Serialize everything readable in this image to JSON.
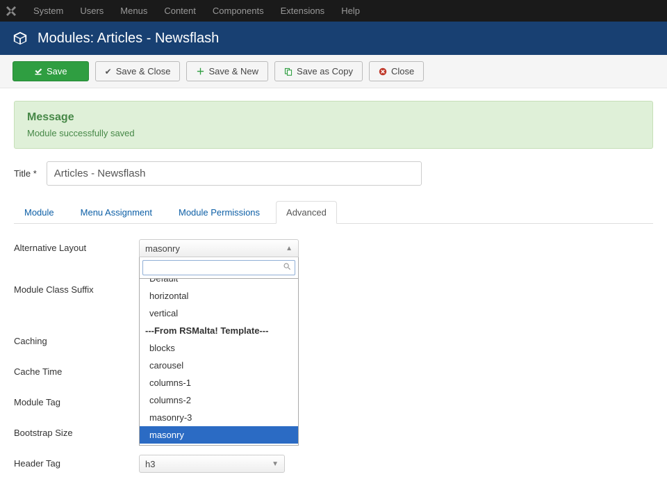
{
  "topnav": {
    "items": [
      "System",
      "Users",
      "Menus",
      "Content",
      "Components",
      "Extensions",
      "Help"
    ]
  },
  "header": {
    "title": "Modules: Articles - Newsflash"
  },
  "toolbar": {
    "save": "Save",
    "saveClose": "Save & Close",
    "saveNew": "Save & New",
    "saveCopy": "Save as Copy",
    "close": "Close"
  },
  "alert": {
    "heading": "Message",
    "text": "Module successfully saved"
  },
  "titleField": {
    "label": "Title *",
    "value": "Articles - Newsflash"
  },
  "tabs": [
    "Module",
    "Menu Assignment",
    "Module Permissions",
    "Advanced"
  ],
  "activeTab": "Advanced",
  "form": {
    "altLayout": {
      "label": "Alternative Layout",
      "selected": "masonry"
    },
    "modClassSuffix": {
      "label": "Module Class Suffix"
    },
    "caching": {
      "label": "Caching"
    },
    "cacheTime": {
      "label": "Cache Time"
    },
    "moduleTag": {
      "label": "Module Tag"
    },
    "bootstrapSize": {
      "label": "Bootstrap Size"
    },
    "headerTag": {
      "label": "Header Tag",
      "selected": "h3"
    }
  },
  "dropdownOptions": {
    "items": [
      {
        "text": "Default",
        "type": "opt"
      },
      {
        "text": "horizontal",
        "type": "opt"
      },
      {
        "text": "vertical",
        "type": "opt"
      },
      {
        "text": "---From RSMalta! Template---",
        "type": "group"
      },
      {
        "text": "blocks",
        "type": "opt"
      },
      {
        "text": "carousel",
        "type": "opt"
      },
      {
        "text": "columns-1",
        "type": "opt"
      },
      {
        "text": "columns-2",
        "type": "opt"
      },
      {
        "text": "masonry-3",
        "type": "opt"
      },
      {
        "text": "masonry",
        "type": "opt",
        "selected": true
      }
    ]
  }
}
